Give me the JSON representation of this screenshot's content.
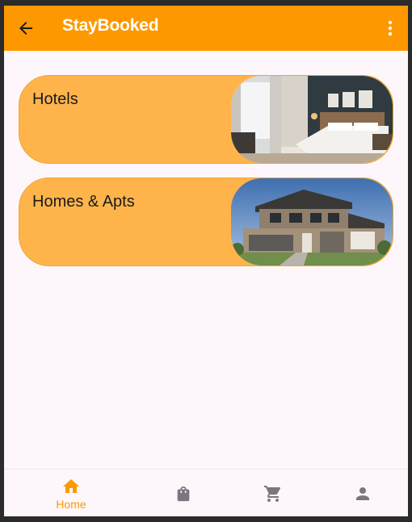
{
  "app": {
    "title": "StayBooked",
    "accent_color": "#fe9800",
    "back_icon": "arrow-left-icon",
    "menu_icon": "more-vert-icon"
  },
  "categories": [
    {
      "label": "Hotels",
      "image": "hotel-bedroom-photo"
    },
    {
      "label": "Homes & Apts",
      "image": "two-story-house-photo"
    }
  ],
  "bottom_nav": {
    "items": [
      {
        "icon": "home-icon",
        "label": "Home",
        "active": true
      },
      {
        "icon": "shopping-bag-icon",
        "label": "",
        "active": false
      },
      {
        "icon": "shopping-cart-icon",
        "label": "",
        "active": false
      },
      {
        "icon": "person-icon",
        "label": "",
        "active": false
      }
    ]
  }
}
